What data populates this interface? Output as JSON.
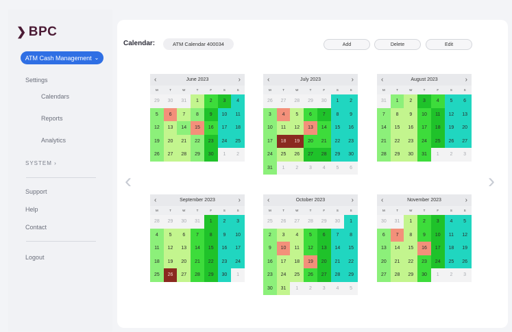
{
  "brand": {
    "logo_text": "BPC",
    "logo_chevron": "❯",
    "color": "#4b1b35"
  },
  "app_selector": {
    "label": "ATM Cash Management",
    "caret": "⌄"
  },
  "nav": {
    "settings": "Settings",
    "calendars": "Calendars",
    "reports": "Reports",
    "analytics": "Analytics",
    "system": "SYSTEM  ›",
    "support": "Support",
    "help": "Help",
    "contact": "Contact",
    "logout": "Logout"
  },
  "toolbar": {
    "calendar_label": "Calendar:",
    "calendar_value": "ATM Calendar 400034",
    "add": "Add",
    "delete": "Delete",
    "edit": "Edit"
  },
  "paging": {
    "prev": "‹",
    "next": "›"
  },
  "weekday_headers": [
    "M",
    "T",
    "W",
    "T",
    "F",
    "S",
    "S"
  ],
  "legend_colors": {
    "c0": "#f3f3f4",
    "c1": "#8cf07a",
    "c2": "#c3f58e",
    "c3": "#3ddc3b",
    "c4": "#1fc22a",
    "c5": "#20d6c0",
    "c6": "#f3907a",
    "c7": "#8a2a20"
  },
  "months": [
    {
      "name": "June 2023",
      "days": [
        [
          "29",
          0
        ],
        [
          "30",
          0
        ],
        [
          "31",
          0
        ],
        [
          "1",
          2
        ],
        [
          "2",
          3
        ],
        [
          "3",
          4
        ],
        [
          "4",
          5
        ],
        [
          "5",
          1
        ],
        [
          "6",
          6
        ],
        [
          "7",
          2
        ],
        [
          "8",
          1
        ],
        [
          "9",
          4
        ],
        [
          "10",
          5
        ],
        [
          "11",
          5
        ],
        [
          "12",
          1
        ],
        [
          "13",
          2
        ],
        [
          "14",
          1
        ],
        [
          "15",
          6
        ],
        [
          "16",
          3
        ],
        [
          "17",
          5
        ],
        [
          "18",
          5
        ],
        [
          "19",
          1
        ],
        [
          "20",
          2
        ],
        [
          "21",
          2
        ],
        [
          "22",
          1
        ],
        [
          "23",
          4
        ],
        [
          "24",
          5
        ],
        [
          "25",
          5
        ],
        [
          "26",
          1
        ],
        [
          "27",
          2
        ],
        [
          "28",
          2
        ],
        [
          "29",
          1
        ],
        [
          "30",
          4
        ],
        [
          "1",
          0
        ],
        [
          "2",
          0
        ]
      ]
    },
    {
      "name": "July 2023",
      "days": [
        [
          "26",
          0
        ],
        [
          "27",
          0
        ],
        [
          "28",
          0
        ],
        [
          "29",
          0
        ],
        [
          "30",
          0
        ],
        [
          "1",
          5
        ],
        [
          "2",
          5
        ],
        [
          "3",
          1
        ],
        [
          "4",
          6
        ],
        [
          "5",
          2
        ],
        [
          "6",
          3
        ],
        [
          "7",
          4
        ],
        [
          "8",
          5
        ],
        [
          "9",
          5
        ],
        [
          "10",
          1
        ],
        [
          "11",
          2
        ],
        [
          "12",
          2
        ],
        [
          "13",
          6
        ],
        [
          "14",
          3
        ],
        [
          "15",
          5
        ],
        [
          "16",
          5
        ],
        [
          "17",
          1
        ],
        [
          "18",
          7
        ],
        [
          "19",
          7
        ],
        [
          "20",
          3
        ],
        [
          "21",
          3
        ],
        [
          "22",
          5
        ],
        [
          "23",
          5
        ],
        [
          "24",
          1
        ],
        [
          "25",
          2
        ],
        [
          "26",
          2
        ],
        [
          "27",
          4
        ],
        [
          "28",
          4
        ],
        [
          "29",
          5
        ],
        [
          "30",
          5
        ],
        [
          "31",
          1
        ],
        [
          "1",
          0
        ],
        [
          "2",
          0
        ],
        [
          "3",
          0
        ],
        [
          "4",
          0
        ],
        [
          "5",
          0
        ],
        [
          "6",
          0
        ]
      ]
    },
    {
      "name": "August 2023",
      "days": [
        [
          "31",
          0
        ],
        [
          "1",
          1
        ],
        [
          "2",
          2
        ],
        [
          "3",
          4
        ],
        [
          "4",
          3
        ],
        [
          "5",
          5
        ],
        [
          "6",
          5
        ],
        [
          "7",
          1
        ],
        [
          "8",
          2
        ],
        [
          "9",
          2
        ],
        [
          "10",
          3
        ],
        [
          "11",
          4
        ],
        [
          "12",
          5
        ],
        [
          "13",
          5
        ],
        [
          "14",
          1
        ],
        [
          "15",
          2
        ],
        [
          "16",
          2
        ],
        [
          "17",
          3
        ],
        [
          "18",
          4
        ],
        [
          "19",
          5
        ],
        [
          "20",
          5
        ],
        [
          "21",
          1
        ],
        [
          "22",
          2
        ],
        [
          "23",
          2
        ],
        [
          "24",
          3
        ],
        [
          "25",
          4
        ],
        [
          "26",
          5
        ],
        [
          "27",
          5
        ],
        [
          "28",
          1
        ],
        [
          "29",
          2
        ],
        [
          "30",
          2
        ],
        [
          "31",
          3
        ],
        [
          "1",
          0
        ],
        [
          "2",
          0
        ],
        [
          "3",
          0
        ]
      ]
    },
    {
      "name": "September 2023",
      "days": [
        [
          "28",
          0
        ],
        [
          "29",
          0
        ],
        [
          "30",
          0
        ],
        [
          "31",
          0
        ],
        [
          "1",
          4
        ],
        [
          "2",
          5
        ],
        [
          "3",
          5
        ],
        [
          "4",
          1
        ],
        [
          "5",
          2
        ],
        [
          "6",
          2
        ],
        [
          "7",
          3
        ],
        [
          "8",
          4
        ],
        [
          "9",
          5
        ],
        [
          "10",
          5
        ],
        [
          "11",
          1
        ],
        [
          "12",
          2
        ],
        [
          "13",
          2
        ],
        [
          "14",
          3
        ],
        [
          "15",
          4
        ],
        [
          "16",
          5
        ],
        [
          "17",
          5
        ],
        [
          "18",
          1
        ],
        [
          "19",
          2
        ],
        [
          "20",
          2
        ],
        [
          "21",
          3
        ],
        [
          "22",
          4
        ],
        [
          "23",
          5
        ],
        [
          "24",
          5
        ],
        [
          "25",
          1
        ],
        [
          "26",
          7
        ],
        [
          "27",
          2
        ],
        [
          "28",
          3
        ],
        [
          "29",
          4
        ],
        [
          "30",
          5
        ],
        [
          "1",
          0
        ]
      ]
    },
    {
      "name": "October 2023",
      "days": [
        [
          "25",
          0
        ],
        [
          "26",
          0
        ],
        [
          "27",
          0
        ],
        [
          "28",
          0
        ],
        [
          "29",
          0
        ],
        [
          "30",
          0
        ],
        [
          "1",
          5
        ],
        [
          "2",
          1
        ],
        [
          "3",
          2
        ],
        [
          "4",
          2
        ],
        [
          "5",
          3
        ],
        [
          "6",
          4
        ],
        [
          "7",
          5
        ],
        [
          "8",
          5
        ],
        [
          "9",
          1
        ],
        [
          "10",
          6
        ],
        [
          "11",
          2
        ],
        [
          "12",
          3
        ],
        [
          "13",
          4
        ],
        [
          "14",
          5
        ],
        [
          "15",
          5
        ],
        [
          "16",
          1
        ],
        [
          "17",
          2
        ],
        [
          "18",
          2
        ],
        [
          "19",
          6
        ],
        [
          "20",
          4
        ],
        [
          "21",
          5
        ],
        [
          "22",
          5
        ],
        [
          "23",
          1
        ],
        [
          "24",
          2
        ],
        [
          "25",
          2
        ],
        [
          "26",
          3
        ],
        [
          "27",
          4
        ],
        [
          "28",
          5
        ],
        [
          "29",
          5
        ],
        [
          "30",
          1
        ],
        [
          "31",
          2
        ],
        [
          "1",
          0
        ],
        [
          "2",
          0
        ],
        [
          "3",
          0
        ],
        [
          "4",
          0
        ],
        [
          "5",
          0
        ]
      ]
    },
    {
      "name": "November 2023",
      "days": [
        [
          "30",
          0
        ],
        [
          "31",
          0
        ],
        [
          "1",
          2
        ],
        [
          "2",
          3
        ],
        [
          "3",
          4
        ],
        [
          "4",
          5
        ],
        [
          "5",
          5
        ],
        [
          "6",
          1
        ],
        [
          "7",
          6
        ],
        [
          "8",
          2
        ],
        [
          "9",
          3
        ],
        [
          "10",
          4
        ],
        [
          "11",
          5
        ],
        [
          "12",
          5
        ],
        [
          "13",
          1
        ],
        [
          "14",
          2
        ],
        [
          "15",
          2
        ],
        [
          "16",
          6
        ],
        [
          "17",
          4
        ],
        [
          "18",
          5
        ],
        [
          "19",
          5
        ],
        [
          "20",
          1
        ],
        [
          "21",
          2
        ],
        [
          "22",
          2
        ],
        [
          "23",
          3
        ],
        [
          "24",
          4
        ],
        [
          "25",
          5
        ],
        [
          "26",
          5
        ],
        [
          "27",
          1
        ],
        [
          "28",
          2
        ],
        [
          "29",
          2
        ],
        [
          "30",
          3
        ],
        [
          "1",
          0
        ],
        [
          "2",
          0
        ],
        [
          "3",
          0
        ]
      ]
    }
  ]
}
